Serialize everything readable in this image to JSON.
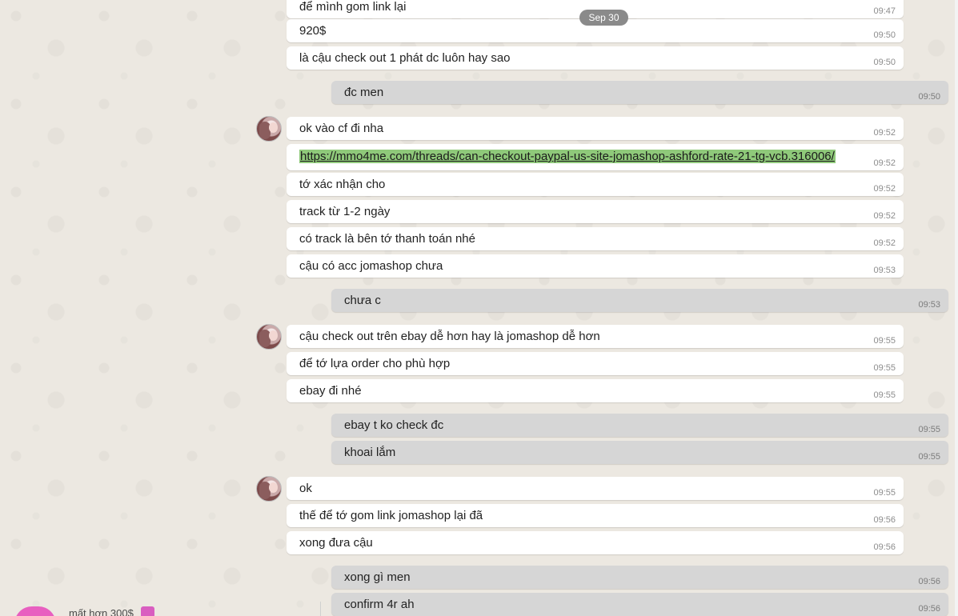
{
  "date_chip": "Sep 30",
  "messages": [
    {
      "dir": "in",
      "text": "để mình gom link lại",
      "time": "09:47"
    },
    {
      "dir": "in",
      "text": "920$",
      "time": "09:50"
    },
    {
      "dir": "in",
      "text": "là cậu check out 1 phát dc luôn hay sao",
      "time": "09:50"
    },
    {
      "dir": "out",
      "text": "đc men",
      "time": "09:50"
    },
    {
      "dir": "in",
      "text": "ok vào cf đi nha",
      "time": "09:52"
    },
    {
      "dir": "in",
      "text": "https://mmo4me.com/threads/can-checkout-paypal-us-site-jomashop-ashford-rate-21-tg-vcb.316006/",
      "time": "09:52"
    },
    {
      "dir": "in",
      "text": "tớ xác nhận cho",
      "time": "09:52"
    },
    {
      "dir": "in",
      "text": "track từ 1-2 ngày",
      "time": "09:52"
    },
    {
      "dir": "in",
      "text": "có track là bên tớ thanh toán nhé",
      "time": "09:52"
    },
    {
      "dir": "in",
      "text": "cậu có acc jomashop chưa",
      "time": "09:53"
    },
    {
      "dir": "out",
      "text": "chưa c",
      "time": "09:53"
    },
    {
      "dir": "in",
      "text": "cậu check out trên ebay dễ hơn hay là jomashop dễ hơn",
      "time": "09:55"
    },
    {
      "dir": "in",
      "text": "để tớ lựa order cho phù hợp",
      "time": "09:55"
    },
    {
      "dir": "in",
      "text": "ebay đi nhé",
      "time": "09:55"
    },
    {
      "dir": "out",
      "text": "ebay t ko check đc",
      "time": "09:55"
    },
    {
      "dir": "out",
      "text": "khoai lắm",
      "time": "09:55"
    },
    {
      "dir": "in",
      "text": "ok",
      "time": "09:55"
    },
    {
      "dir": "in",
      "text": "thế để tớ gom link jomashop lại đã",
      "time": "09:56"
    },
    {
      "dir": "in",
      "text": "xong đưa cậu",
      "time": "09:56"
    },
    {
      "dir": "out",
      "text": "xong gì men",
      "time": "09:56"
    },
    {
      "dir": "out",
      "text": "confirm 4r ah",
      "time": "09:56"
    }
  ],
  "bottom_preview": {
    "text": "mất hơn 300$"
  },
  "colors": {
    "background": "#ece8e1",
    "incoming_bubble": "#ffffff",
    "outgoing_bubble": "#d6d6d6",
    "link_highlight": "#8fc97a",
    "date_chip": "#8a8a8a"
  }
}
